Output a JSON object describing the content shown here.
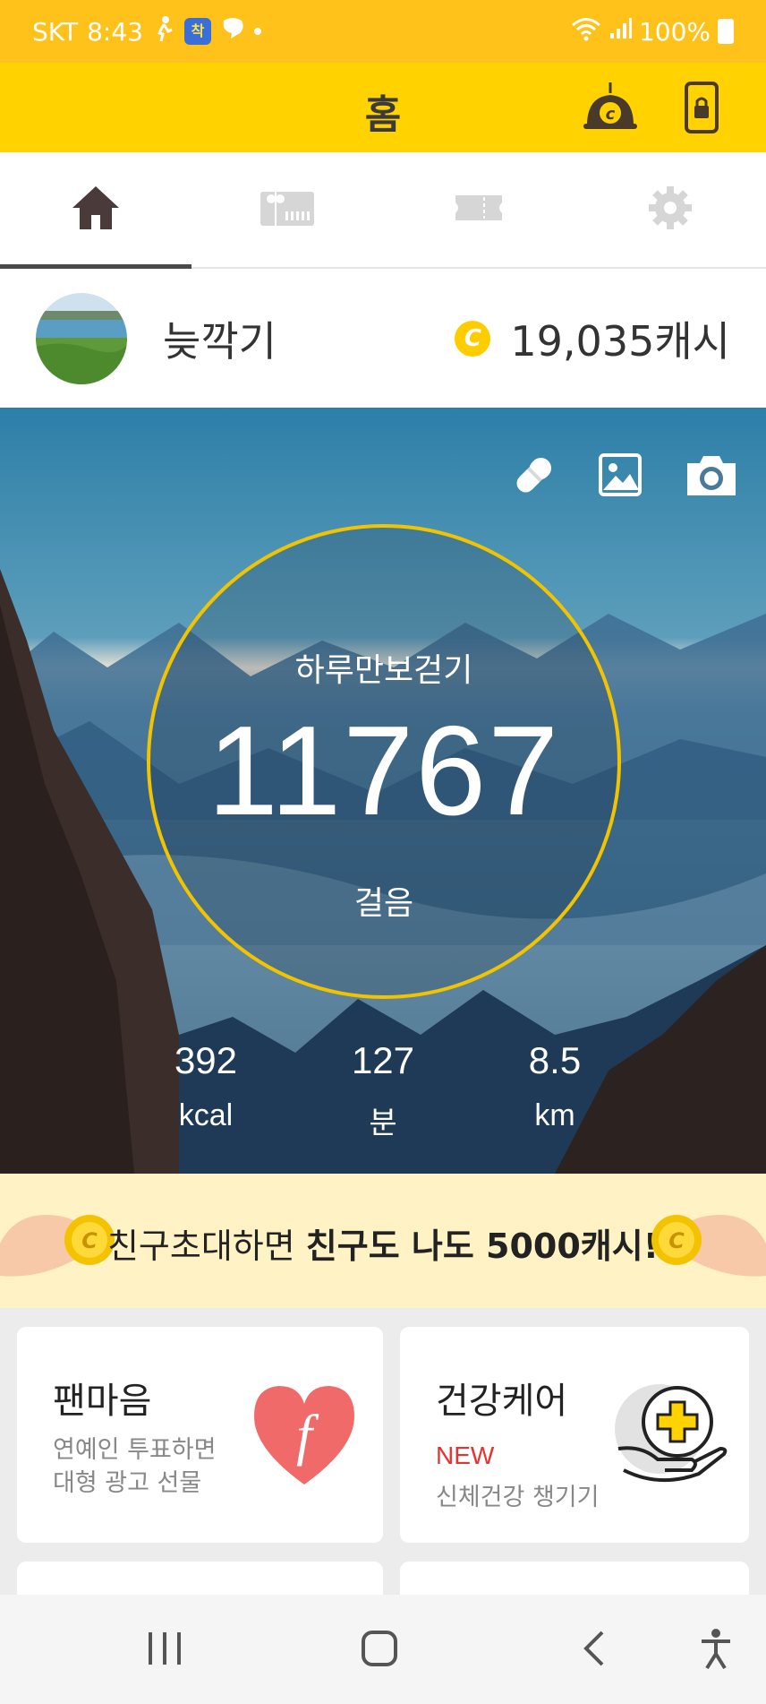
{
  "status_bar": {
    "carrier": "SKT",
    "time": "8:43",
    "badge": "착",
    "battery": "100%"
  },
  "header": {
    "title": "홈",
    "icons": [
      "cash-bot-icon",
      "phone-lock-icon"
    ]
  },
  "tabs": [
    {
      "icon": "home-icon",
      "active": true
    },
    {
      "icon": "gift-store-icon",
      "active": false
    },
    {
      "icon": "ticket-icon",
      "active": false
    },
    {
      "icon": "gear-icon",
      "active": false
    }
  ],
  "profile": {
    "nickname": "늦깍기",
    "cash": "19,035캐시",
    "coin_letter": "C"
  },
  "pedometer": {
    "label": "하루만보걷기",
    "steps": "11767",
    "unit": "걸음",
    "stats": [
      {
        "value": "392",
        "unit": "kcal"
      },
      {
        "value": "127",
        "unit": "분"
      },
      {
        "value": "8.5",
        "unit": "km"
      }
    ]
  },
  "banner": {
    "text_normal": "친구초대하면 ",
    "text_bold": "친구도 나도 5000캐시!"
  },
  "cards": [
    {
      "title": "팬마음",
      "line1": "연예인 투표하면",
      "line2": "대형 광고 선물"
    },
    {
      "title": "건강케어",
      "badge": "NEW",
      "line1": "신체건강 챙기기"
    }
  ],
  "colors": {
    "accent": "#ffd200",
    "status": "#ffc21a",
    "coin": "#ffcc00",
    "new": "#e8322f",
    "heart": "#f16a6a"
  }
}
